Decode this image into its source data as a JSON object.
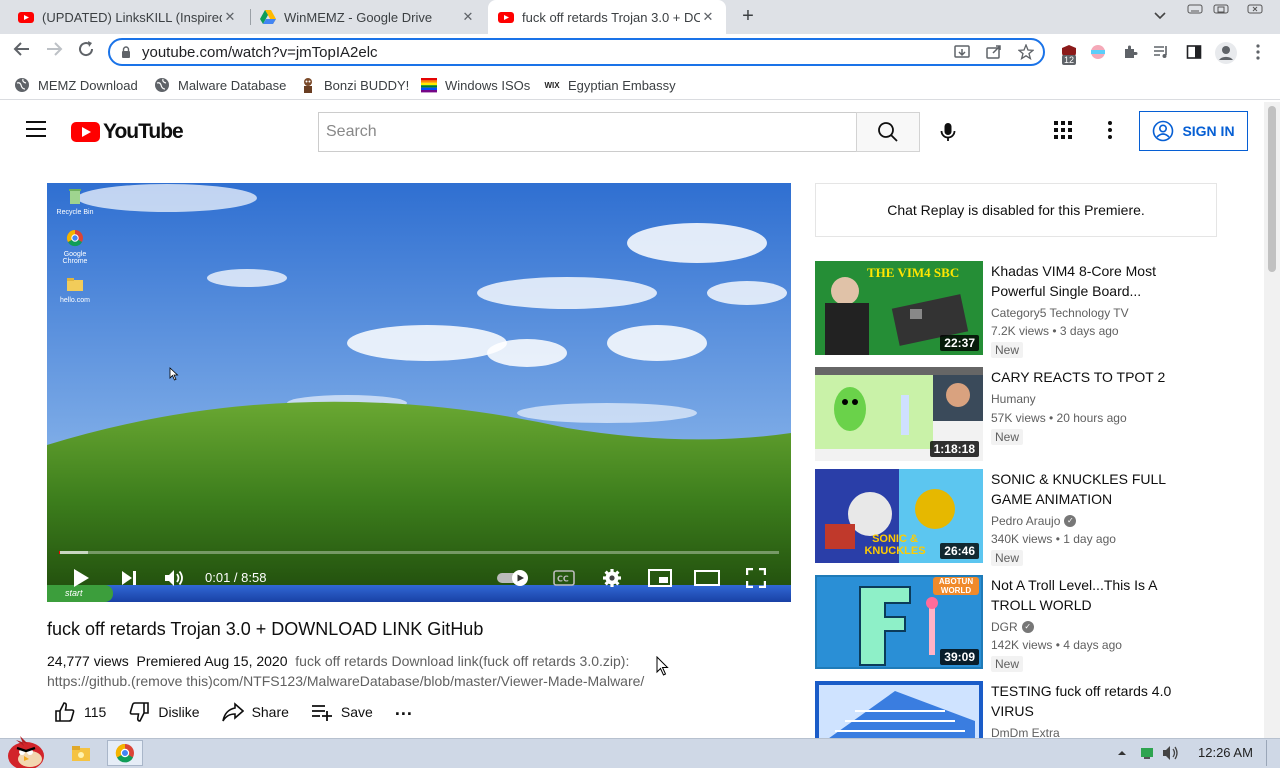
{
  "browser": {
    "tabs": [
      {
        "title": "(UPDATED) LinksKILL (Inspired",
        "favicon": "youtube-icon",
        "active": false
      },
      {
        "title": "WinMEMZ - Google Drive",
        "favicon": "google-drive-icon",
        "active": false
      },
      {
        "title": "fuck off retards Trojan 3.0 + DO",
        "favicon": "youtube-icon",
        "active": true
      }
    ],
    "tab_close": "✕",
    "new_tab": "+",
    "url": "youtube.com/watch?v=jmTopIA2elc",
    "extension_badge": "12",
    "bookmarks": [
      {
        "label": "MEMZ Download",
        "icon": "globe-icon"
      },
      {
        "label": "Malware Database",
        "icon": "globe-icon"
      },
      {
        "label": "Bonzi BUDDY!",
        "icon": "bonzi-icon"
      },
      {
        "label": "Windows ISOs",
        "icon": "rainbow-flag-icon"
      },
      {
        "label": "Egyptian Embassy",
        "icon": "wix-icon"
      }
    ],
    "wix_text": "WIX"
  },
  "youtube": {
    "logo_text": "YouTube",
    "search_placeholder": "Search",
    "signin_label": "SIGN IN"
  },
  "player": {
    "time": "0:01 / 8:58",
    "progress_fraction": 0.0019,
    "buffered_fraction": 0.04,
    "desktop_icons": [
      "Recycle Bin",
      "Google Chrome",
      "hello.com"
    ],
    "xp_start_label": "start"
  },
  "video": {
    "title": "fuck off retards Trojan 3.0 + DOWNLOAD LINK GitHub",
    "views": "24,777 views",
    "premiered": "Premiered Aug 15, 2020",
    "description_line1": "fuck off retards Download link(fuck off retards 3.0.zip):",
    "description_line2": "https://github.(remove this)com/NTFS123/MalwareDatabase/blob/master/Viewer-Made-Malware/",
    "likes": "115",
    "dislike_label": "Dislike",
    "share_label": "Share",
    "save_label": "Save",
    "more_label": "..."
  },
  "sidebar": {
    "chat_replay": "Chat Replay is disabled for this Premiere.",
    "recommendations": [
      {
        "title": "Khadas VIM4 8-Core Most Powerful Single Board...",
        "channel": "Category5 Technology TV",
        "verified": false,
        "meta": "7.2K views • 3 days ago",
        "badge": "New",
        "duration": "22:37",
        "thumb_text": "THE VIM4 SBC"
      },
      {
        "title": "CARY REACTS TO TPOT 2",
        "channel": "Humany",
        "verified": false,
        "meta": "57K views • 20 hours ago",
        "badge": "New",
        "duration": "1:18:18",
        "thumb_text": ""
      },
      {
        "title": "SONIC & KNUCKLES FULL GAME ANIMATION",
        "channel": "Pedro Araujo",
        "verified": true,
        "meta": "340K views • 1 day ago",
        "badge": "New",
        "duration": "26:46",
        "thumb_text": "SONIC & KNUCKLES"
      },
      {
        "title": "Not A Troll Level...This Is A TROLL WORLD",
        "channel": "DGR",
        "verified": true,
        "meta": "142K views • 4 days ago",
        "badge": "New",
        "duration": "39:09",
        "thumb_text": "ABOTUN WORLD"
      },
      {
        "title": "TESTING fuck off retards 4.0 VIRUS",
        "channel": "DmDm Extra",
        "verified": false,
        "meta": "",
        "badge": "",
        "duration": "",
        "thumb_text": ""
      }
    ]
  },
  "taskbar": {
    "clock": "12:26 AM"
  },
  "colors": {
    "accent_blue": "#1a73e8",
    "youtube_red": "#ff0000",
    "signin_blue": "#065fd4"
  }
}
